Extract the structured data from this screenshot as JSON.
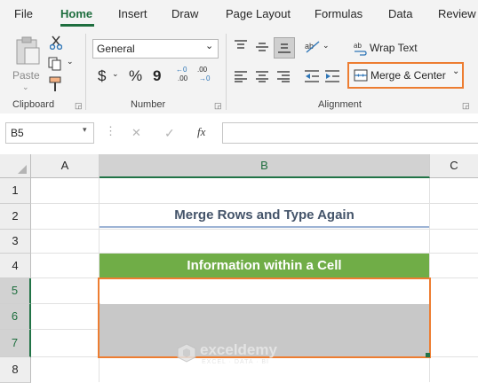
{
  "tabs": [
    "File",
    "Home",
    "Insert",
    "Draw",
    "Page Layout",
    "Formulas",
    "Data",
    "Review"
  ],
  "ribbon": {
    "clipboard": {
      "paste_label": "Paste",
      "group_label": "Clipboard"
    },
    "number": {
      "format_value": "General",
      "currency_symbol": "$",
      "percent_symbol": "%",
      "comma_symbol": "9",
      "group_label": "Number"
    },
    "alignment": {
      "wrap_text_label": "Wrap Text",
      "merge_center_label": "Merge & Center",
      "group_label": "Alignment"
    }
  },
  "formula_bar": {
    "name_box": "B5",
    "cancel_symbol": "✕",
    "enter_symbol": "✓",
    "function_symbol": "fx"
  },
  "grid": {
    "columns": [
      "A",
      "B",
      "C"
    ],
    "rows": [
      "1",
      "2",
      "3",
      "4",
      "5",
      "6",
      "7",
      "8"
    ],
    "title_cell": "Merge Rows and Type Again",
    "header_cell": "Information within a Cell"
  },
  "watermark": {
    "brand": "exceldemy",
    "tagline": "EXCEL · DATA · BI"
  },
  "colors": {
    "accent_green": "#1e6e3e",
    "header_fill": "#70ad47",
    "highlight_orange": "#ed7d31",
    "title_text": "#44546a",
    "selection_fill": "#c8c8c8"
  }
}
